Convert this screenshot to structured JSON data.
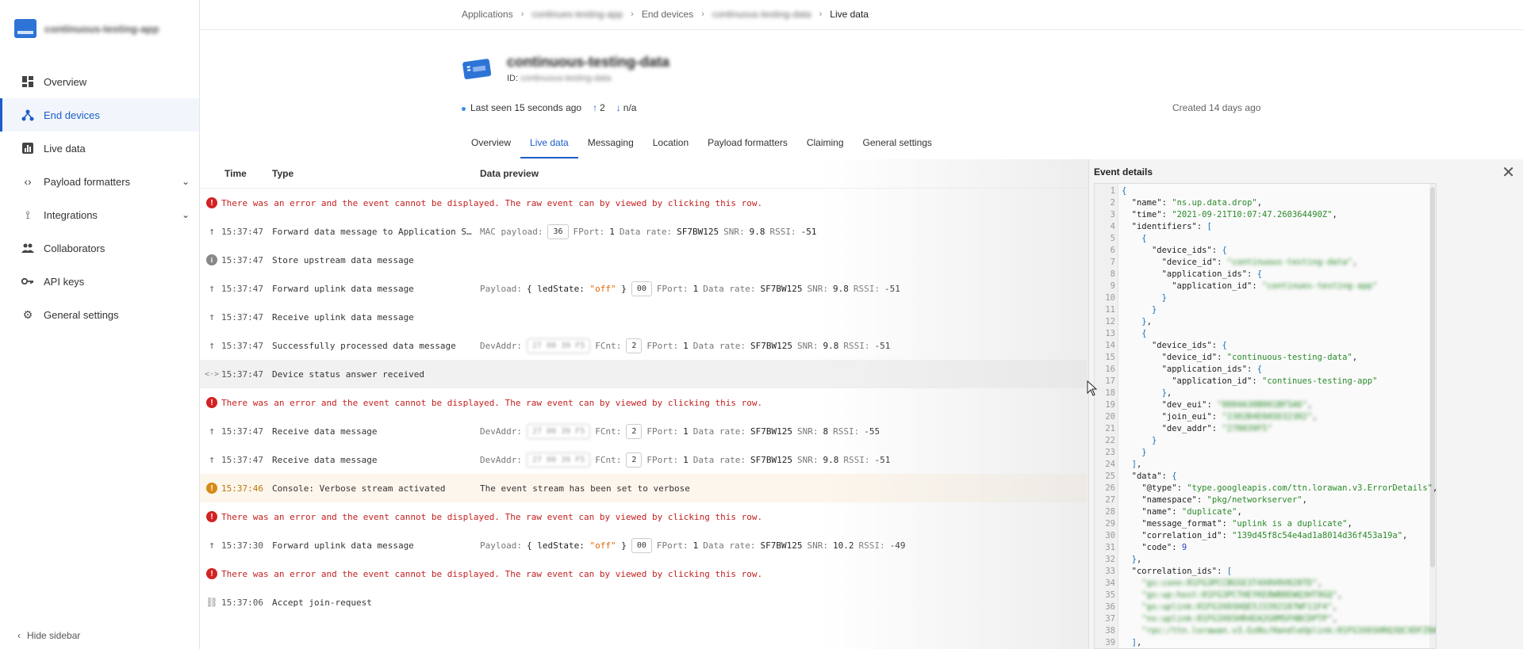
{
  "sidebar": {
    "app_name": "continuous-testing-app",
    "items": [
      {
        "label": "Overview",
        "icon": "grid-icon"
      },
      {
        "label": "End devices",
        "icon": "devices-icon"
      },
      {
        "label": "Live data",
        "icon": "chart-icon"
      },
      {
        "label": "Payload formatters",
        "icon": "code-icon"
      },
      {
        "label": "Integrations",
        "icon": "integrations-icon"
      },
      {
        "label": "Collaborators",
        "icon": "people-icon"
      },
      {
        "label": "API keys",
        "icon": "key-icon"
      },
      {
        "label": "General settings",
        "icon": "gear-icon"
      }
    ],
    "hide_label": "Hide sidebar"
  },
  "breadcrumb": {
    "items": [
      "Applications",
      "continues-testing-app",
      "End devices",
      "continuous-testing-data",
      "Live data"
    ]
  },
  "device": {
    "title": "continuous-testing-data",
    "id_label": "ID:",
    "id_value": "continuous-testing-data",
    "last_seen": "Last seen 15 seconds ago",
    "up_count": "2",
    "down_count": "n/a",
    "created": "Created 14 days ago"
  },
  "tabs": [
    "Overview",
    "Live data",
    "Messaging",
    "Location",
    "Payload formatters",
    "Claiming",
    "General settings"
  ],
  "table": {
    "headers": {
      "time": "Time",
      "type": "Type",
      "preview": "Data preview"
    },
    "error_msg": "There was an error and the event cannot be displayed. The raw event can by viewed by clicking this row.",
    "rows": [
      {
        "time": "15:37:47",
        "type": "Forward data message to Application S…",
        "mac_label": "MAC payload:",
        "mac_val": "36",
        "fport": "1",
        "rate": "SF7BW125",
        "snr": "9.8",
        "rssi": "-51"
      },
      {
        "time": "15:37:47",
        "type": "Store upstream data message"
      },
      {
        "time": "15:37:47",
        "type": "Forward uplink data message",
        "payload_key": "ledState",
        "payload_val": "\"off\"",
        "box": "00",
        "fport": "1",
        "rate": "SF7BW125",
        "snr": "9.8",
        "rssi": "-51"
      },
      {
        "time": "15:37:47",
        "type": "Receive uplink data message"
      },
      {
        "time": "15:37:47",
        "type": "Successfully processed data message",
        "devaddr": "27 00 39 F5",
        "fcnt": "2",
        "fport": "1",
        "rate": "SF7BW125",
        "snr": "9.8",
        "rssi": "-51"
      },
      {
        "time": "15:37:47",
        "type": "Device status answer received"
      },
      {
        "time": "15:37:47",
        "type": "Receive data message",
        "devaddr": "27 00 39 F5",
        "fcnt": "2",
        "fport": "1",
        "rate": "SF7BW125",
        "snr": "8",
        "rssi": "-55"
      },
      {
        "time": "15:37:47",
        "type": "Receive data message",
        "devaddr": "27 00 39 F5",
        "fcnt": "2",
        "fport": "1",
        "rate": "SF7BW125",
        "snr": "9.8",
        "rssi": "-51"
      },
      {
        "time": "15:37:46",
        "type": "Console: Verbose stream activated",
        "preview": "The event stream has been set to verbose"
      },
      {
        "time": "15:37:30",
        "type": "Forward uplink data message",
        "payload_key": "ledState",
        "payload_val": "\"off\"",
        "box": "00",
        "fport": "1",
        "rate": "SF7BW125",
        "snr": "10.2",
        "rssi": "-49"
      },
      {
        "time": "15:37:06",
        "type": "Accept join-request"
      }
    ],
    "labels": {
      "payload": "Payload:",
      "devaddr": "DevAddr:",
      "fcnt": "FCnt:",
      "fport": "FPort:",
      "rate": "Data rate:",
      "snr": "SNR:",
      "rssi": "RSSI:"
    }
  },
  "details": {
    "title": "Event details",
    "lines": [
      "{",
      "  \"name\": \"ns.up.data.drop\",",
      "  \"time\": \"2021-09-21T10:07:47.260364490Z\",",
      "  \"identifiers\": [",
      "    {",
      "      \"device_ids\": {",
      "        \"device_id\": \"continuous-testing-data\",",
      "        \"application_ids\": {",
      "          \"application_id\": \"continues-testing-app\"",
      "        }",
      "      }",
      "    },",
      "    {",
      "      \"device_ids\": {",
      "        \"device_id\": \"continuous-testing-data\",",
      "        \"application_ids\": {",
      "          \"application_id\": \"continues-testing-app\"",
      "        },",
      "        \"dev_eui\": \"0004A30B001BF5A6\",",
      "        \"join_eui\": \"2302B4E0A5D32302\",",
      "        \"dev_addr\": \"270039F5\"",
      "      }",
      "    }",
      "  ],",
      "  \"data\": {",
      "    \"@type\": \"type.googleapis.com/ttn.lorawan.v3.ErrorDetails\",",
      "    \"namespace\": \"pkg/networkserver\",",
      "    \"name\": \"duplicate\",",
      "    \"message_format\": \"uplink is a duplicate\",",
      "    \"correlation_id\": \"139d45f8c54e4ad1a8014d36f453a19a\",",
      "    \"code\": 9",
      "  },",
      "  \"correlation_ids\": [",
      "    \"gs:conn:01FG3PCCBGSE3T4X0V0V828TD\",",
      "    \"gs:up:host:01FG3PCTHEYKE8WB8EWQ3HT9GQ\",",
      "    \"gs:uplink:01FG3X6SHQE5J3392187WF11F4\",",
      "    \"ns:uplink:01FG3X6SHR4EA2G0MSFHBCDPTP\",",
      "    \"rpc:/ttn.lorawan.v3.GsNs/HandleUplink:01FG3X6SHRQ3QCXDFZ0A4A0F\",",
      "  ],"
    ],
    "blurred_lines": [
      7,
      9,
      19,
      20,
      21,
      34,
      35,
      36,
      37,
      38
    ]
  },
  "colors": {
    "accent": "#1c5dc9",
    "error": "#c41f1f",
    "warn": "#d68a14",
    "json_string": "#2a8a2a",
    "json_number": "#2a3fd0"
  }
}
